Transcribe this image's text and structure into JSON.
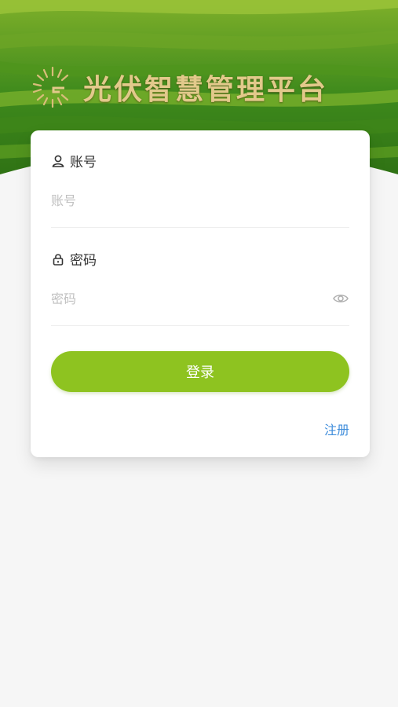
{
  "header": {
    "title": "光伏智慧管理平台",
    "logo_icon": "sunburst-g-logo-icon"
  },
  "form": {
    "account": {
      "label": "账号",
      "icon": "user-icon",
      "placeholder": "账号",
      "value": ""
    },
    "password": {
      "label": "密码",
      "icon": "lock-icon",
      "placeholder": "密码",
      "value": "",
      "toggle_icon": "eye-icon"
    },
    "login_label": "登录",
    "register_label": "注册"
  },
  "colors": {
    "accent": "#8ec320",
    "link": "#3f8ddb",
    "background": "#f6f6f6",
    "title_gold": "#e2c98b"
  }
}
